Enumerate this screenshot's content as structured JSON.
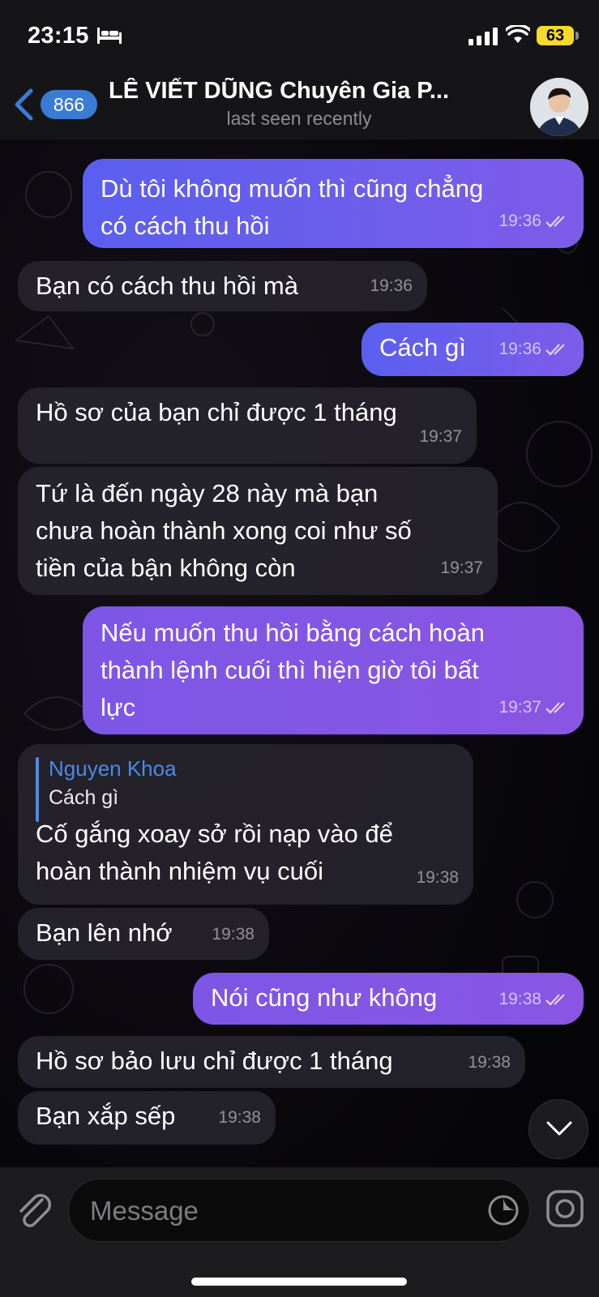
{
  "status_bar": {
    "time": "23:15",
    "battery": "63"
  },
  "header": {
    "back_badge": "866",
    "title": "LÊ VIẾT DŨNG Chuyên Gia P...",
    "subtitle": "last seen recently"
  },
  "messages": [
    {
      "dir": "out",
      "text": "Dù tôi không muốn thì cũng chẳng\ncó cách thu hồi",
      "time": "19:36"
    },
    {
      "dir": "in",
      "text": "Bạn có cách thu hồi mà",
      "time": "19:36"
    },
    {
      "dir": "out",
      "text": "Cách gì",
      "time": "19:36"
    },
    {
      "dir": "in",
      "text": "Hồ sơ của bạn chỉ được 1 tháng",
      "time": "19:37"
    },
    {
      "dir": "in",
      "text": "Tứ là đến ngày 28 này mà bạn\nchưa hoàn thành xong coi như số\ntiền của bận không còn",
      "time": "19:37"
    },
    {
      "dir": "out",
      "text": "Nếu muốn thu hồi bằng cách hoàn\nthành lệnh cuối thì hiện giờ tôi bất\nlực",
      "time": "19:37"
    },
    {
      "dir": "in",
      "reply_name": "Nguyen Khoa",
      "reply_text": "Cách gì",
      "text": "Cố gắng xoay sở rồi nạp vào để\nhoàn thành nhiệm vụ cuối",
      "time": "19:38"
    },
    {
      "dir": "in",
      "text": "Bạn lên nhớ",
      "time": "19:38"
    },
    {
      "dir": "out",
      "text": "Nói cũng như không",
      "time": "19:38"
    },
    {
      "dir": "in",
      "text": "Hồ sơ bảo lưu chỉ được 1 tháng",
      "time": "19:38"
    },
    {
      "dir": "in",
      "text": "Bạn xắp sếp",
      "time": "19:38"
    }
  ],
  "composer": {
    "placeholder": "Message"
  },
  "icons": {
    "sleep": "bed-icon",
    "signal": "cellular-signal-icon",
    "wifi": "wifi-icon",
    "back": "chevron-left-icon",
    "read": "double-check-icon",
    "scroll": "chevron-down-icon",
    "attach": "paperclip-icon",
    "sticker": "sticker-icon",
    "camera": "camera-icon"
  },
  "colors": {
    "accent": "#3a7bd5",
    "outgoing_bubble": "#5a5ff0",
    "incoming_bubble": "#26242c"
  }
}
